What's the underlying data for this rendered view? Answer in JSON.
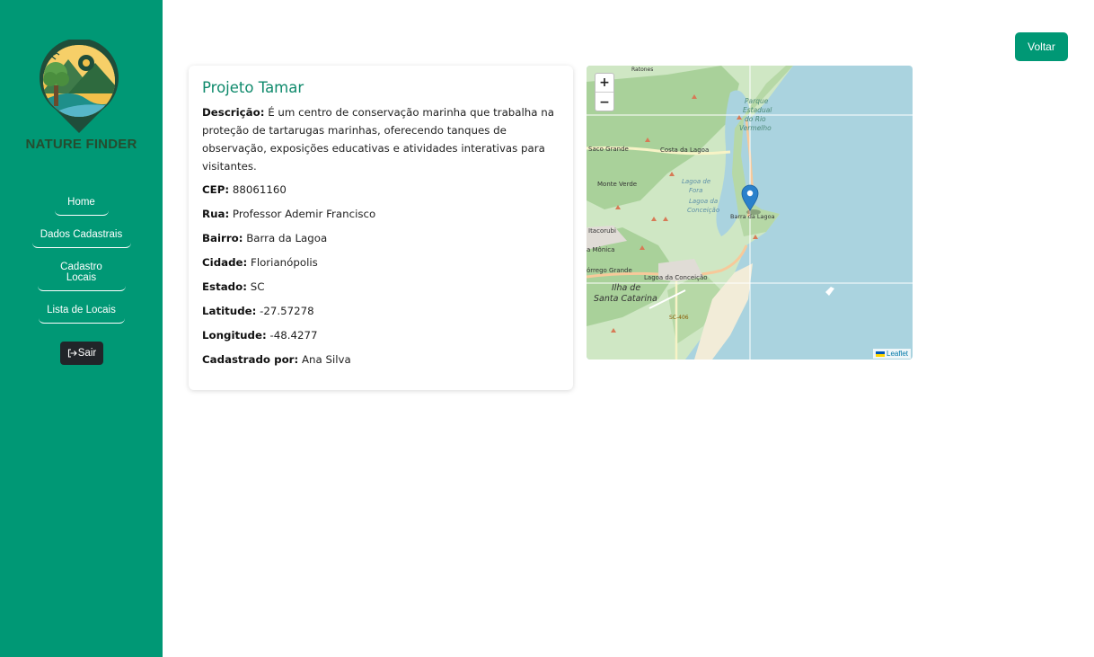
{
  "sidebar": {
    "brand": "NATURE FINDER",
    "nav": {
      "home": "Home",
      "dados": "Dados Cadastrais",
      "cadastro": "Cadastro Locais",
      "lista": "Lista de Locais"
    },
    "logout": "Sair"
  },
  "header": {
    "back": "Voltar"
  },
  "place": {
    "title": "Projeto Tamar",
    "fields": {
      "descricao_label": "Descrição:",
      "descricao": "É um centro de conservação marinha que trabalha na proteção de tartarugas marinhas, oferecendo tanques de observação, exposições educativas e atividades interativas para visitantes.",
      "cep_label": "CEP:",
      "cep": "88061160",
      "rua_label": "Rua:",
      "rua": "Professor Ademir Francisco",
      "bairro_label": "Bairro:",
      "bairro": "Barra da Lagoa",
      "cidade_label": "Cidade:",
      "cidade": "Florianópolis",
      "estado_label": "Estado:",
      "estado": "SC",
      "latitude_label": "Latitude:",
      "latitude": "-27.57278",
      "longitude_label": "Longitude:",
      "longitude": "-48.4277",
      "cadastrado_label": "Cadastrado por:",
      "cadastrado": "Ana Silva"
    }
  },
  "map": {
    "zoom_in": "+",
    "zoom_out": "−",
    "attribution": "Leaflet",
    "labels": {
      "parque": "Parque",
      "estadual": "Estadual",
      "do_rio": "do Rio",
      "vermelho": "Vermelho",
      "saco_grande": "Saco Grande",
      "costa_lagoa": "Costa da Lagoa",
      "monte_verde": "Monte Verde",
      "lagoa_de": "Lagoa de",
      "fora": "Fora",
      "lagoa_da": "Lagoa da",
      "conceicao": "Conceição",
      "barra_lagoa": "Barra da Lagoa",
      "itacorubi": "Itacorubi",
      "santa_monica": "a Mônica",
      "corrego_grande": "órrego Grande",
      "lagoa_conceicao": "Lagoa da Conceição",
      "ilha_de": "Ilha de",
      "santa_catarina": "Santa Catarina",
      "sc406": "SC-406",
      "ratones": "Ratones"
    }
  },
  "colors": {
    "primary": "#009875",
    "sidebar": "#009875",
    "dark_button": "#212529",
    "title": "#0f8a6c"
  },
  "icons": {
    "logout": "sign-out-icon",
    "marker": "map-marker-icon",
    "logo": "nature-finder-logo"
  }
}
